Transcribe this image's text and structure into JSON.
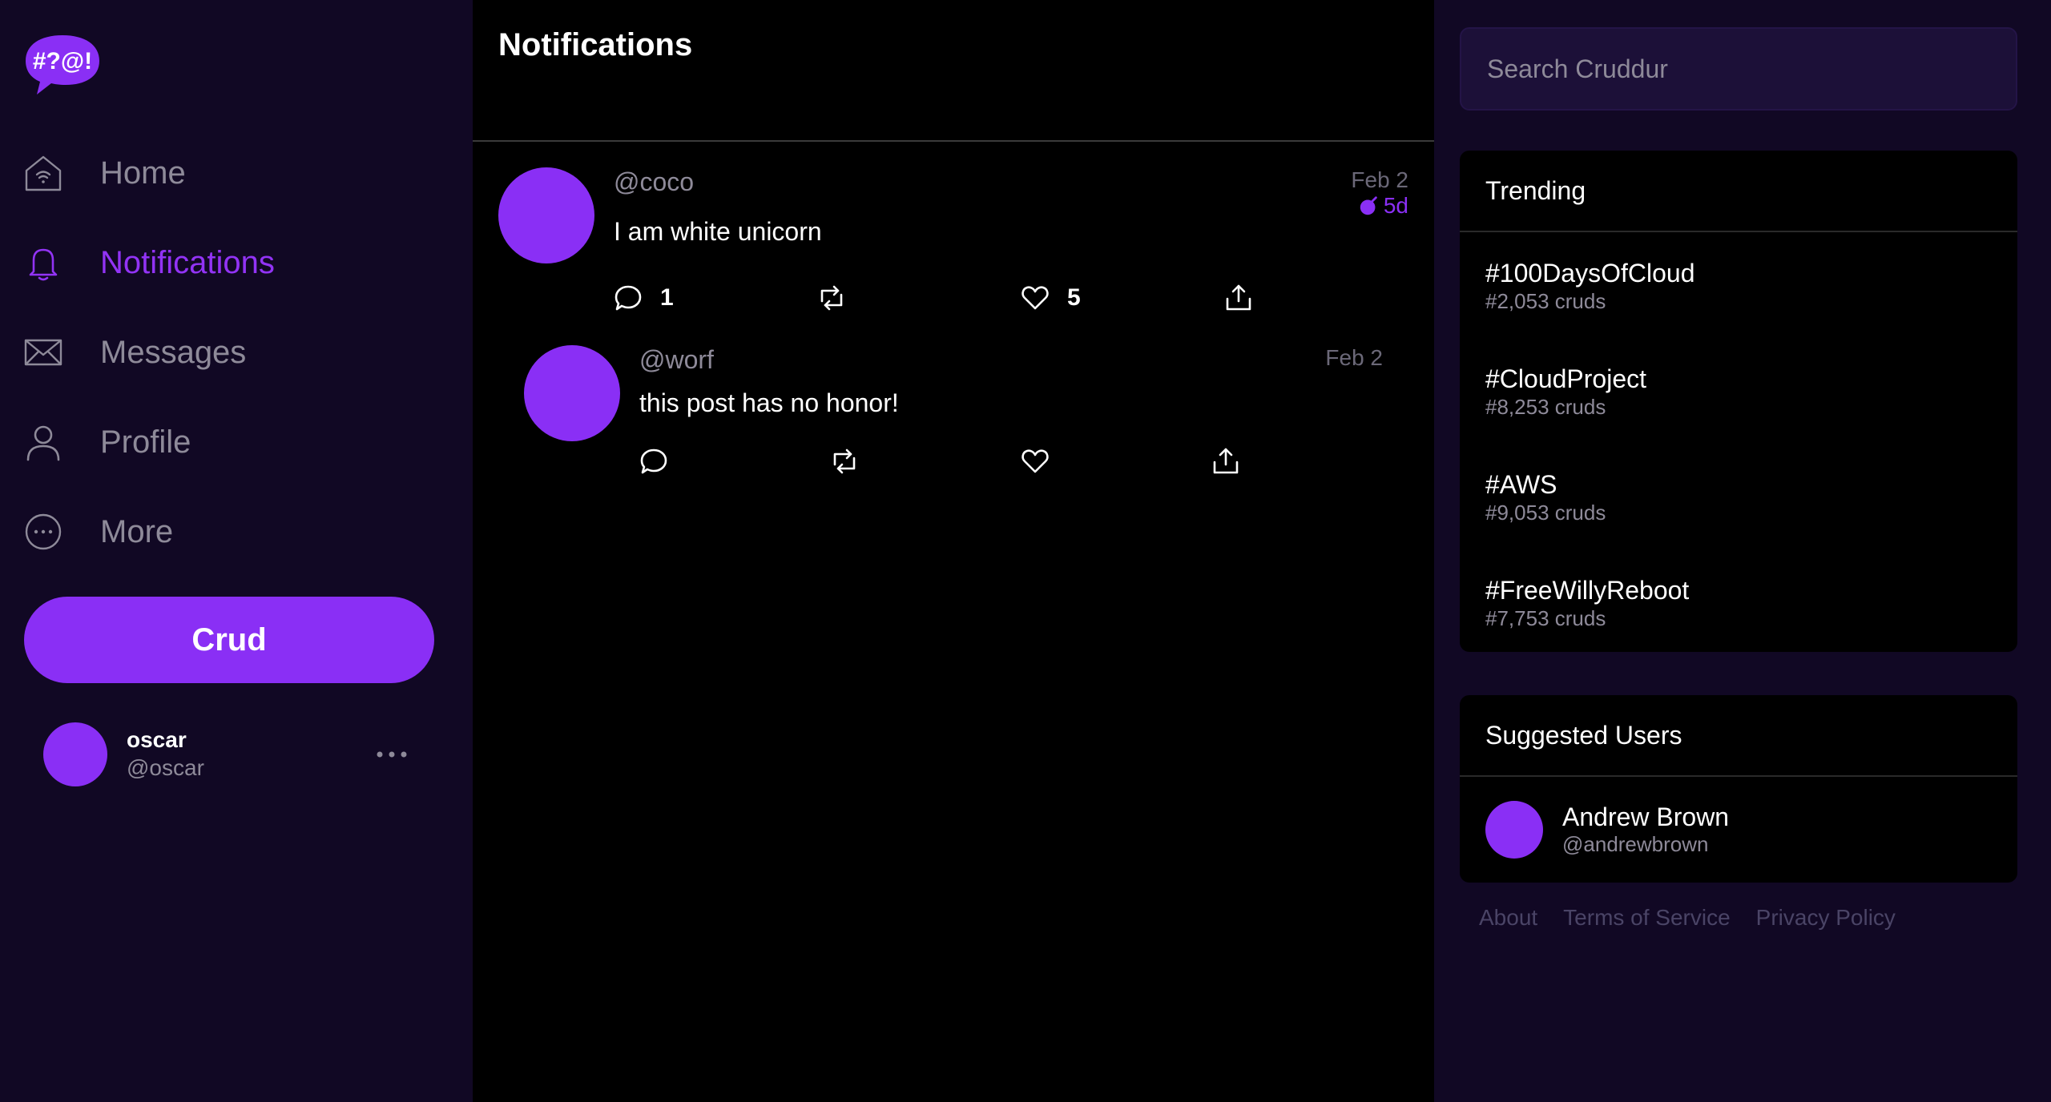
{
  "app": {
    "logo_text": "#?@!",
    "accent_color": "#8a2ff5"
  },
  "nav": {
    "items": [
      {
        "label": "Home",
        "icon": "home-icon",
        "active": false
      },
      {
        "label": "Notifications",
        "icon": "bell-icon",
        "active": true
      },
      {
        "label": "Messages",
        "icon": "envelope-icon",
        "active": false
      },
      {
        "label": "Profile",
        "icon": "person-icon",
        "active": false
      },
      {
        "label": "More",
        "icon": "more-circle-icon",
        "active": false
      }
    ],
    "crud_label": "Crud"
  },
  "profile": {
    "name": "oscar",
    "handle": "@oscar"
  },
  "main": {
    "title": "Notifications",
    "activities": [
      {
        "handle": "@coco",
        "date": "Feb 2",
        "expires": "5d",
        "message": "I am white unicorn",
        "replies": "1",
        "reposts": "",
        "likes": "5"
      },
      {
        "handle": "@worf",
        "date": "Feb 2",
        "expires": "",
        "message": "this post has no honor!",
        "replies": "",
        "reposts": "",
        "likes": ""
      }
    ]
  },
  "search": {
    "placeholder": "Search Cruddur"
  },
  "trending": {
    "title": "Trending",
    "items": [
      {
        "tag": "#100DaysOfCloud",
        "count": "#2,053 cruds"
      },
      {
        "tag": "#CloudProject",
        "count": "#8,253 cruds"
      },
      {
        "tag": "#AWS",
        "count": "#9,053 cruds"
      },
      {
        "tag": "#FreeWillyReboot",
        "count": "#7,753 cruds"
      }
    ]
  },
  "suggested": {
    "title": "Suggested Users",
    "users": [
      {
        "name": "Andrew Brown",
        "handle": "@andrewbrown"
      }
    ]
  },
  "footer": {
    "links": [
      "About",
      "Terms of Service",
      "Privacy Policy"
    ]
  }
}
